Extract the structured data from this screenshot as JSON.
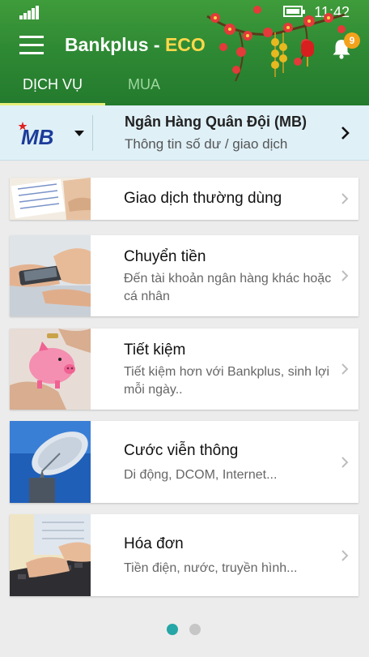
{
  "status_bar": {
    "time": "11:42",
    "signal_icon": "signal-bars-icon",
    "battery_icon": "battery-icon"
  },
  "header": {
    "title_main": "Bankplus - ",
    "title_accent": "ECO",
    "menu_icon": "hamburger-menu-icon",
    "notification_icon": "bell-icon",
    "notification_count": "9",
    "tabs": [
      {
        "label": "DỊCH VỤ",
        "active": true
      },
      {
        "label": "MUA",
        "active": false
      }
    ]
  },
  "bank_selector": {
    "logo_text": "MB",
    "name": "Ngân Hàng Quân Đội (MB)",
    "subtitle": "Thông tin số dư / giao dịch"
  },
  "services": [
    {
      "title": "Giao dịch thường dùng",
      "description": ""
    },
    {
      "title": "Chuyển tiền",
      "description": "Đến tài khoản ngân hàng khác hoặc cá nhân"
    },
    {
      "title": "Tiết kiệm",
      "description": "Tiết kiệm hơn với Bankplus, sinh lợi mỗi ngày.."
    },
    {
      "title": "Cước viễn thông",
      "description": "Di động, DCOM, Internet..."
    },
    {
      "title": "Hóa đơn",
      "description": "Tiền điện, nước, truyền hình..."
    }
  ],
  "pager": {
    "total": 2,
    "active_index": 0
  },
  "colors": {
    "header_green": "#2f8a34",
    "accent_yellow": "#ffd84a",
    "bank_bar_bg": "#dff0f7",
    "badge_orange": "#f3a21b",
    "pager_active": "#26a6a6"
  }
}
